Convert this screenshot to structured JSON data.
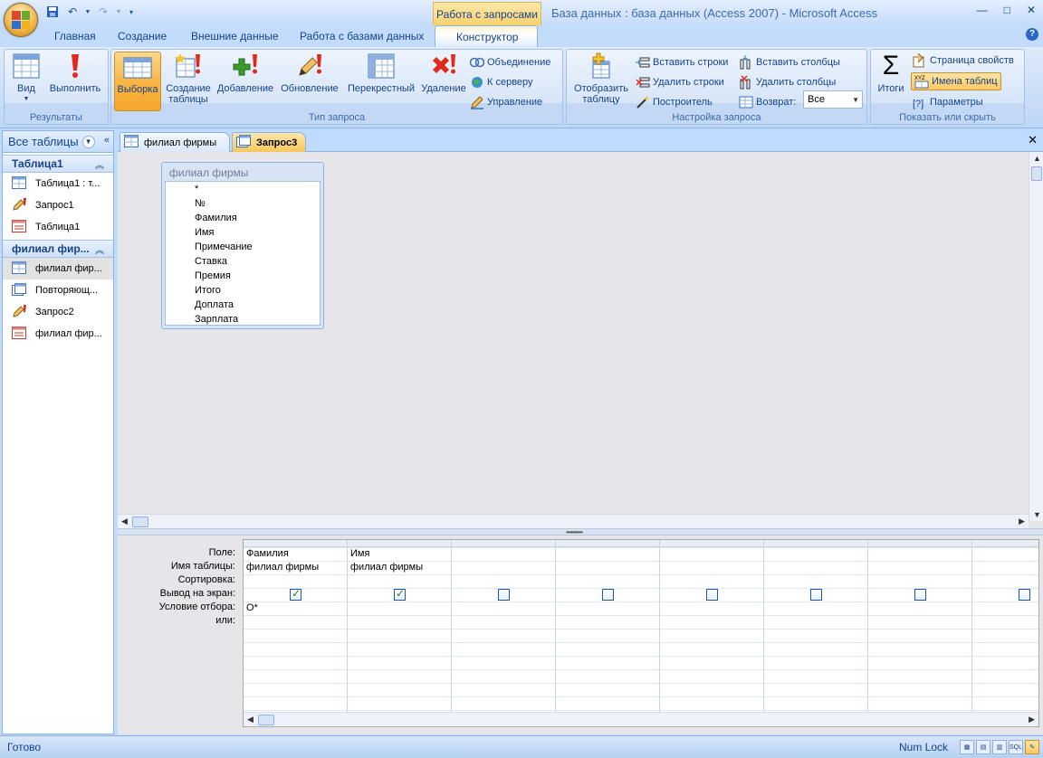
{
  "window": {
    "contextual_tab_title": "Работа с запросами",
    "title": "База данных : база данных (Access 2007)  -  Microsoft Access"
  },
  "tabs": [
    "Главная",
    "Создание",
    "Внешние данные",
    "Работа с базами данных",
    "Конструктор"
  ],
  "ribbon": {
    "results": {
      "label": "Результаты",
      "view": "Вид",
      "run": "Выполнить"
    },
    "query_type": {
      "label": "Тип запроса",
      "select": "Выборка",
      "make_table_1": "Создание",
      "make_table_2": "таблицы",
      "append": "Добавление",
      "update": "Обновление",
      "crosstab": "Перекрестный",
      "delete": "Удаление",
      "union": "Объединение",
      "pass_through": "К серверу",
      "data_definition": "Управление"
    },
    "query_setup": {
      "label": "Настройка запроса",
      "show_table_1": "Отобразить",
      "show_table_2": "таблицу",
      "insert_rows": "Вставить строки",
      "delete_rows": "Удалить строки",
      "builder": "Построитель",
      "insert_columns": "Вставить столбцы",
      "delete_columns": "Удалить столбцы",
      "return_label": "Возврат:",
      "return_value": "Все"
    },
    "show_hide": {
      "label": "Показать или скрыть",
      "totals": "Итоги",
      "property_sheet": "Страница свойств",
      "table_names": "Имена таблиц",
      "parameters": "Параметры"
    }
  },
  "nav": {
    "header": "Все таблицы",
    "groups": [
      {
        "name": "Таблица1",
        "items": [
          "Таблица1 : т...",
          "Запрос1",
          "Таблица1"
        ]
      },
      {
        "name": "филиал фир...",
        "items": [
          "филиал фир...",
          "Повторяющ...",
          "Запрос2",
          "филиал фир..."
        ]
      }
    ]
  },
  "doc_tabs": [
    "филиал фирмы",
    "Запрос3"
  ],
  "field_list": {
    "title": "филиал фирмы",
    "fields": [
      "*",
      "№",
      "Фамилия",
      "Имя",
      "Примечание",
      "Ставка",
      "Премия",
      "Итого",
      "Доплата",
      "Зарплата"
    ]
  },
  "grid": {
    "row_labels": [
      "Поле:",
      "Имя таблицы:",
      "Сортировка:",
      "Вывод на экран:",
      "Условие отбора:",
      "или:"
    ],
    "columns": [
      {
        "field": "Фамилия",
        "table": "филиал фирмы",
        "show": true,
        "criteria": "О*"
      },
      {
        "field": "Имя",
        "table": "филиал фирмы",
        "show": true,
        "criteria": ""
      },
      {
        "field": "",
        "table": "",
        "show": false,
        "criteria": ""
      },
      {
        "field": "",
        "table": "",
        "show": false,
        "criteria": ""
      },
      {
        "field": "",
        "table": "",
        "show": false,
        "criteria": ""
      },
      {
        "field": "",
        "table": "",
        "show": false,
        "criteria": ""
      },
      {
        "field": "",
        "table": "",
        "show": false,
        "criteria": ""
      },
      {
        "field": "",
        "table": "",
        "show": false,
        "criteria": ""
      }
    ]
  },
  "status": {
    "text": "Готово",
    "numlock": "Num Lock",
    "sql_view": "SQL"
  }
}
